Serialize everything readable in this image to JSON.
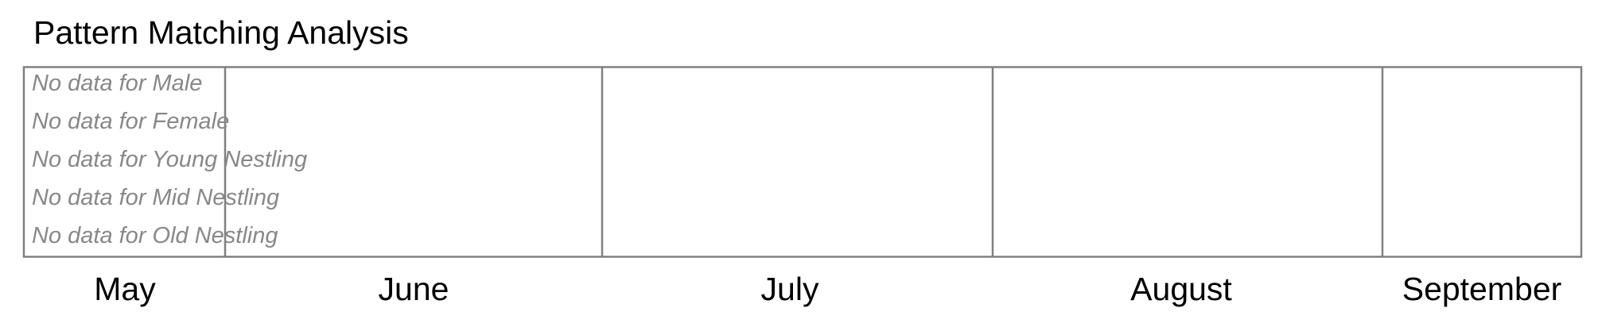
{
  "chart_data": {
    "type": "timeline",
    "title": "Pattern Matching Analysis",
    "months": [
      "May",
      "June",
      "July",
      "August",
      "September"
    ],
    "empty_messages": [
      "No data for Male",
      "No data for Female",
      "No data for Young Nestling",
      "No data for Mid Nestling",
      "No data for Old Nestling"
    ],
    "colors": {
      "border": "#808080",
      "empty_message": "#888888",
      "text": "#000000"
    }
  }
}
